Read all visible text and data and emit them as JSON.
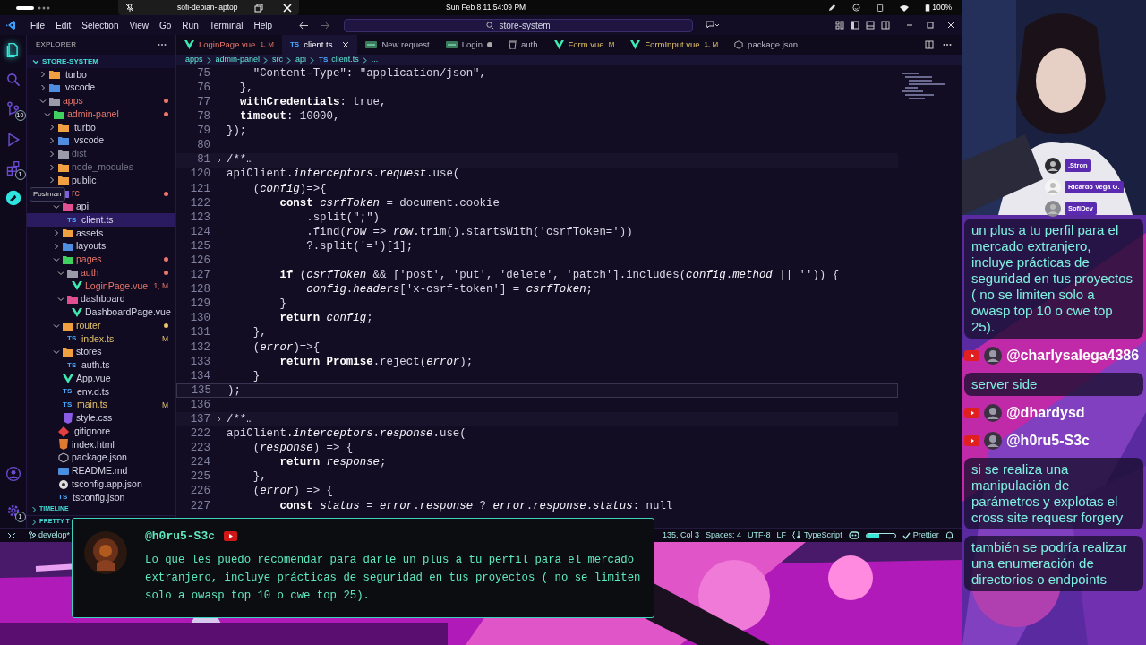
{
  "system_bar": {
    "window_title": "sofi-debian-laptop",
    "clock": "Sun Feb 8 11:54:09 PM",
    "battery": "100%"
  },
  "menu": [
    "File",
    "Edit",
    "Selection",
    "View",
    "Go",
    "Run",
    "Terminal",
    "Help"
  ],
  "command_center": {
    "value": "store-system"
  },
  "activity_bar": [
    {
      "kind": "files",
      "selected": true
    },
    {
      "kind": "search",
      "selected": false
    },
    {
      "kind": "source-control",
      "selected": false,
      "badge": "10"
    },
    {
      "kind": "debug",
      "selected": false
    },
    {
      "kind": "extensions",
      "selected": false,
      "badge": "1"
    },
    {
      "kind": "postman",
      "selected": false
    }
  ],
  "activity_bottom": [
    {
      "kind": "account"
    },
    {
      "kind": "settings",
      "badge": "1"
    }
  ],
  "tooltip": "Postman",
  "explorer": {
    "title": "EXPLORER",
    "root": "STORE-SYSTEM",
    "tree": [
      {
        "name": ".turbo",
        "kind": "folder",
        "expanded": false
      },
      {
        "name": ".vscode",
        "kind": "folder",
        "expanded": false
      },
      {
        "name": "apps",
        "kind": "folder",
        "expanded": true,
        "error": true,
        "children": [
          {
            "name": "admin-panel",
            "kind": "folder",
            "expanded": true,
            "error": true,
            "children": [
              {
                "name": ".turbo",
                "kind": "folder",
                "expanded": false
              },
              {
                "name": ".vscode",
                "kind": "folder",
                "expanded": false
              },
              {
                "name": "dist",
                "kind": "folder",
                "expanded": false,
                "ignored": true
              },
              {
                "name": "node_modules",
                "kind": "folder",
                "expanded": false,
                "ignored": true
              },
              {
                "name": "public",
                "kind": "folder",
                "expanded": false
              },
              {
                "name": "rc",
                "kind": "folder",
                "expanded": true,
                "error": true,
                "children": [
                  {
                    "name": "api",
                    "kind": "folder",
                    "expanded": true,
                    "children": [
                      {
                        "name": "client.ts",
                        "icon": "TS",
                        "selected": true
                      }
                    ]
                  },
                  {
                    "name": "assets",
                    "kind": "folder",
                    "expanded": false
                  },
                  {
                    "name": "layouts",
                    "kind": "folder",
                    "expanded": false
                  },
                  {
                    "name": "pages",
                    "kind": "folder",
                    "expanded": true,
                    "error": true,
                    "children": [
                      {
                        "name": "auth",
                        "kind": "folder",
                        "expanded": true,
                        "error": true,
                        "children": [
                          {
                            "name": "LoginPage.vue",
                            "kind": "vue",
                            "error": true,
                            "badge": "1, M"
                          }
                        ]
                      },
                      {
                        "name": "dashboard",
                        "kind": "folder",
                        "expanded": true,
                        "children": [
                          {
                            "name": "DashboardPage.vue",
                            "kind": "vue"
                          }
                        ]
                      }
                    ]
                  },
                  {
                    "name": "router",
                    "kind": "folder",
                    "expanded": true,
                    "modified": true,
                    "children": [
                      {
                        "name": "index.ts",
                        "icon": "TS",
                        "modified": true,
                        "badge": "M"
                      }
                    ]
                  },
                  {
                    "name": "stores",
                    "kind": "folder",
                    "expanded": true,
                    "children": [
                      {
                        "name": "auth.ts",
                        "icon": "TS"
                      }
                    ]
                  },
                  {
                    "name": "App.vue",
                    "kind": "vue"
                  },
                  {
                    "name": "env.d.ts",
                    "icon": "TS"
                  },
                  {
                    "name": "main.ts",
                    "icon": "TS",
                    "modified": true,
                    "badge": "M"
                  },
                  {
                    "name": "style.css",
                    "kind": "css"
                  }
                ]
              },
              {
                "name": ".gitignore",
                "kind": "git"
              },
              {
                "name": "index.html",
                "kind": "html"
              },
              {
                "name": "package.json",
                "kind": "json"
              },
              {
                "name": "README.md",
                "kind": "md"
              },
              {
                "name": "tsconfig.app.json",
                "kind": "config"
              },
              {
                "name": "tsconfig.json",
                "icon": "TS"
              }
            ]
          }
        ]
      }
    ]
  },
  "panels": [
    "TIMELINE",
    "PRETTY T"
  ],
  "tabs": [
    {
      "label": "LoginPage.vue",
      "kind": "vue",
      "error": true,
      "badge": "1, M",
      "selected": false
    },
    {
      "label": "client.ts",
      "icon": "TS",
      "selected": true
    },
    {
      "label": "New request",
      "kind": "http",
      "selected": false
    },
    {
      "label": "Login",
      "kind": "http",
      "dirty": true,
      "selected": false
    },
    {
      "label": "auth",
      "kind": "collection",
      "selected": false
    },
    {
      "label": "Form.vue",
      "kind": "vue",
      "modified": true,
      "badge": "M",
      "selected": false
    },
    {
      "label": "FormInput.vue",
      "kind": "vue",
      "modified": true,
      "badge": "1, M",
      "selected": false
    },
    {
      "label": "package.json",
      "kind": "json",
      "selected": false
    }
  ],
  "breadcrumb": [
    "apps",
    "admin-panel",
    "src",
    "api",
    "client.ts",
    "..."
  ],
  "breadcrumb_icon": "TS",
  "code": [
    {
      "n": "75",
      "t": "    \"Content-Type\": \"application/json\","
    },
    {
      "n": "76",
      "t": "  },"
    },
    {
      "n": "77",
      "t": "  **withCredentials**: true,"
    },
    {
      "n": "78",
      "t": "  **timeout**: 10000,"
    },
    {
      "n": "79",
      "t": "});"
    },
    {
      "n": "80"
    },
    {
      "n": "81",
      "kind": "folded",
      "t": "/**…"
    },
    {
      "n": "120",
      "t": "apiClient.*interceptors*.*request*.use("
    },
    {
      "n": "121",
      "t": "    (*config*)=>{"
    },
    {
      "n": "122",
      "t": "        **const** *csrfToken* = document.cookie"
    },
    {
      "n": "123",
      "t": "            .split(\";\")"
    },
    {
      "n": "124",
      "t": "            .find(*row* => *row*.trim().startsWith('csrfToken='))"
    },
    {
      "n": "125",
      "t": "            ?.split('=')[1];"
    },
    {
      "n": "126"
    },
    {
      "n": "127",
      "t": "        **if** (*csrfToken* && ['post', 'put', 'delete', 'patch'].includes(*config*.*method* || '')) {"
    },
    {
      "n": "128",
      "t": "            *config*.*headers*['x-csrf-token'] = *csrfToken*;"
    },
    {
      "n": "129",
      "t": "        }"
    },
    {
      "n": "130",
      "t": "        **return** *config*;"
    },
    {
      "n": "131",
      "t": "    },"
    },
    {
      "n": "132",
      "t": "    (*error*)=>{"
    },
    {
      "n": "133",
      "t": "        **return** **Promise**.reject(*error*);"
    },
    {
      "n": "134",
      "t": "    }"
    },
    {
      "n": "135",
      "current": true,
      "t": ");"
    },
    {
      "n": "136"
    },
    {
      "n": "137",
      "kind": "folded",
      "t": "/**…"
    },
    {
      "n": "222",
      "t": "apiClient.*interceptors*.*response*.use("
    },
    {
      "n": "223",
      "t": "    (*response*) => {"
    },
    {
      "n": "224",
      "t": "        **return** *response*;"
    },
    {
      "n": "225",
      "t": "    },"
    },
    {
      "n": "226",
      "t": "    (*error*) => {"
    },
    {
      "n": "227",
      "t": "        **const** *status* = *error*.*response* ? *error*.*response*.*status*: null"
    }
  ],
  "status_bar": {
    "branch": "develop*",
    "items": [
      {
        "kind": "text",
        "text": "135, Col 3"
      },
      {
        "kind": "text",
        "text": "Spaces: 4"
      },
      {
        "kind": "text",
        "text": "UTF-8"
      },
      {
        "kind": "text",
        "text": "LF"
      },
      {
        "kind": "lang",
        "text": "TypeScript"
      },
      {
        "kind": "copilot"
      },
      {
        "kind": "progress",
        "level": 0.45
      },
      {
        "kind": "prettier",
        "text": "Prettier"
      },
      {
        "kind": "bell"
      }
    ]
  },
  "highlight": {
    "author": "@h0ru5-S3c",
    "message": "Lo que les puedo recomendar para darle un plus a tu perfil para el mercado extranjero, incluye prácticas de seguridad en tus proyectos ( no se limiten solo a owasp top 10 o cwe top 25)."
  },
  "viewers": [
    ".Stron",
    "Ricardo Vega G.",
    "SofiDev"
  ],
  "chat": [
    {
      "kind": "message",
      "text": "un plus a tu perfil para el mercado extranjero, incluye prácticas de seguridad en tus proyectos ( no se limiten solo a owasp top 10 o cwe top 25)."
    },
    {
      "kind": "author",
      "text": "@charlysalega4386"
    },
    {
      "kind": "message",
      "text": "server side"
    },
    {
      "kind": "author",
      "text": "@dhardysd"
    },
    {
      "kind": "author",
      "text": "@h0ru5-S3c"
    },
    {
      "kind": "message",
      "text": "si se realiza una manipulación de parámetros y explotas el cross site requesr forgery"
    },
    {
      "kind": "message",
      "text": "también se podría realizar una enumeración de directorios o endpoints"
    }
  ]
}
